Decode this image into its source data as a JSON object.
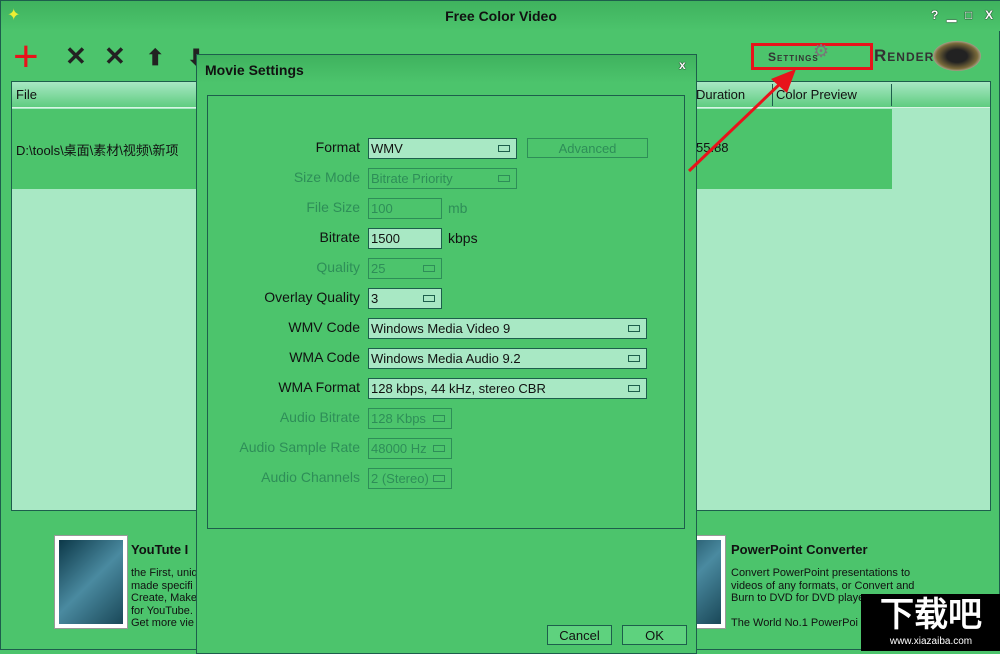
{
  "window": {
    "title": "Free Color Video",
    "help": "?",
    "minimize": "▁",
    "maximize": "□",
    "close": "X"
  },
  "toolbar": {
    "add": "+",
    "remove": "✕",
    "remove_all": "✕",
    "up": "⬆",
    "down": "⬇",
    "settings_label": "Settings",
    "render_label": "Render"
  },
  "file_list": {
    "columns": [
      "File",
      "Duration",
      "Color Preview"
    ],
    "rows": [
      {
        "file": "D:\\tools\\桌面\\素材\\视频\\新项",
        "duration": "55.88"
      }
    ]
  },
  "ads": [
    {
      "title": "YouTute I",
      "lines": [
        "the First, uniq",
        "made specifi",
        "Create, Make",
        "for YouTube.",
        "Get more vie"
      ]
    },
    {
      "title": "PowerPoint Converter",
      "lines": [
        "Convert PowerPoint presentations to",
        "videos of any formats, or Convert and",
        "Burn to DVD for DVD playe",
        "",
        "The World No.1 PowerPoi"
      ]
    }
  ],
  "dialog": {
    "title": "Movie Settings",
    "close": "x",
    "advanced": "Advanced",
    "cancel": "Cancel",
    "ok": "OK",
    "fields": [
      {
        "label": "Format",
        "value": "WMV",
        "type": "select",
        "enabled": true
      },
      {
        "label": "Size Mode",
        "value": "Bitrate Priority",
        "type": "select",
        "enabled": false
      },
      {
        "label": "File Size",
        "value": "100",
        "unit": "mb",
        "type": "text",
        "enabled": false
      },
      {
        "label": "Bitrate",
        "value": "1500",
        "unit": "kbps",
        "type": "text",
        "enabled": true
      },
      {
        "label": "Quality",
        "value": "25",
        "type": "select",
        "enabled": false
      },
      {
        "label": "Overlay Quality",
        "value": "3",
        "type": "select",
        "enabled": true
      },
      {
        "label": "WMV Code",
        "value": "Windows Media Video 9",
        "type": "select",
        "enabled": true
      },
      {
        "label": "WMA Code",
        "value": "Windows Media Audio 9.2",
        "type": "select",
        "enabled": true
      },
      {
        "label": "WMA Format",
        "value": "128 kbps, 44 kHz, stereo CBR",
        "type": "select",
        "enabled": true
      },
      {
        "label": "Audio Bitrate",
        "value": "128 Kbps",
        "type": "select",
        "enabled": false
      },
      {
        "label": "Audio Sample Rate",
        "value": "48000 Hz",
        "type": "select",
        "enabled": false
      },
      {
        "label": "Audio Channels",
        "value": "2 (Stereo)",
        "type": "select",
        "enabled": false
      }
    ]
  },
  "watermark": {
    "logo": "下载吧",
    "url": "www.xiazaiba.com"
  },
  "colors": {
    "bg": "#4cc46c",
    "light": "#a8e8c4",
    "border": "#1d5e4c",
    "annotation": "#e8131b"
  }
}
